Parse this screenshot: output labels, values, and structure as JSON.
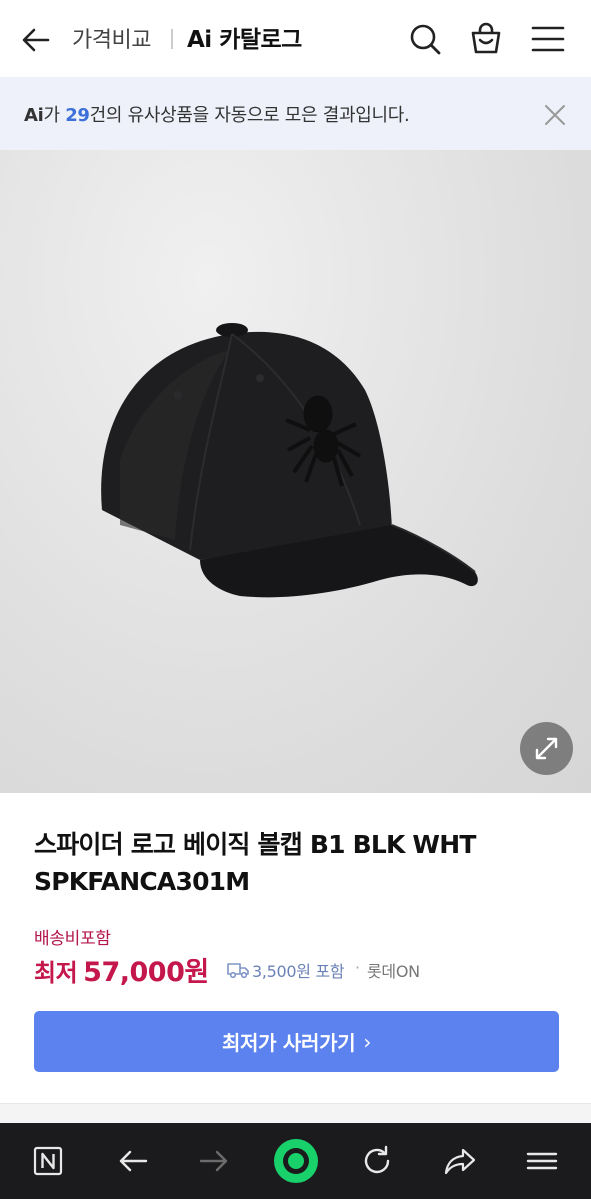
{
  "header": {
    "breadcrumb": "가격비교",
    "title": "Ai 카탈로그"
  },
  "ai_banner": {
    "logo": "Ai",
    "text_before": "가 ",
    "count": "29",
    "text_after": "건의 유사상품을 자동으로 모은 결과입니다."
  },
  "product": {
    "name": "스파이더 로고 베이직 볼캡 B1 BLK WHT SPKFANCA301M",
    "shipping_label": "배송비포함",
    "price_prefix": "최저",
    "price": "57,000원",
    "shipping_fee": "3,500원 포함",
    "seller_separator": "·",
    "seller": "롯데ON"
  },
  "cta": {
    "label": "최저가 사러가기",
    "arrow": "›"
  },
  "colors": {
    "accent": "#5b82ee",
    "price": "#c4174c",
    "ai_count": "#3d6fd9"
  },
  "icons": {
    "header": [
      "back-arrow-icon",
      "search-icon",
      "cart-icon",
      "menu-icon"
    ],
    "banner": [
      "close-icon"
    ],
    "image": [
      "expand-icon"
    ],
    "browser_bar": [
      "n-home-icon",
      "back-icon",
      "forward-icon",
      "green-circle-icon",
      "refresh-icon",
      "share-icon",
      "menu-icon"
    ]
  }
}
